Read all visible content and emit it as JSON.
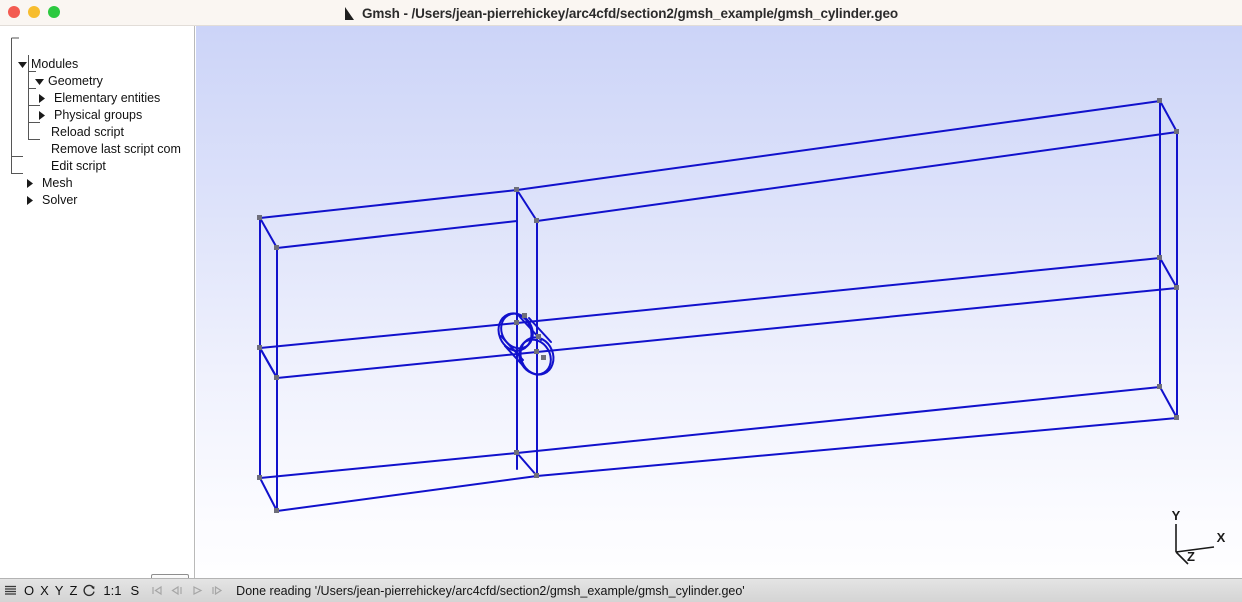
{
  "window": {
    "title": "Gmsh - /Users/jean-pierrehickey/arc4cfd/section2/gmsh_example/gmsh_cylinder.geo",
    "logo_icon": "gmsh-triangle-logo",
    "traffic_lights": [
      {
        "name": "close",
        "color": "#f35b51"
      },
      {
        "name": "minimize",
        "color": "#f7bd2e"
      },
      {
        "name": "zoom",
        "color": "#2cc940"
      }
    ],
    "titlebar_bg": "#faf6f2"
  },
  "sidebar": {
    "tree": [
      {
        "label": "Modules",
        "indent": 0,
        "toggle": "expanded"
      },
      {
        "label": "Geometry",
        "indent": 1,
        "toggle": "expanded"
      },
      {
        "label": "Elementary entities",
        "indent": 2,
        "toggle": "collapsed"
      },
      {
        "label": "Physical groups",
        "indent": 2,
        "toggle": "collapsed"
      },
      {
        "label": "Reload script",
        "indent": 2,
        "toggle": "leaf"
      },
      {
        "label": "Remove last script com",
        "indent": 2,
        "toggle": "leaf"
      },
      {
        "label": "Edit script",
        "indent": 2,
        "toggle": "leaf"
      },
      {
        "label": "Mesh",
        "indent": 1,
        "toggle": "collapsed"
      },
      {
        "label": "Solver",
        "indent": 1,
        "toggle": "collapsed"
      }
    ],
    "options_button": {
      "icon": "gear-icon",
      "dropdown_icon": "triangle-down-icon"
    }
  },
  "viewport": {
    "background_top": "#ccd4f8",
    "background_bottom": "#fefeff",
    "geometry_color": "#1111cc",
    "vertex_color": "#6e6e7a",
    "axes": {
      "y_label": "Y",
      "x_label": "X",
      "z_label": "Z"
    }
  },
  "statusbar": {
    "buttons": [
      {
        "name": "menu",
        "label": "",
        "icon": "hamburger-icon",
        "dim": false
      },
      {
        "name": "ortho",
        "label": "O",
        "icon": "",
        "dim": false
      },
      {
        "name": "x-view",
        "label": "X",
        "icon": "",
        "dim": false
      },
      {
        "name": "y-view",
        "label": "Y",
        "icon": "",
        "dim": false
      },
      {
        "name": "z-view",
        "label": "Z",
        "icon": "",
        "dim": false
      },
      {
        "name": "rotate",
        "label": "",
        "icon": "rotate-icon",
        "dim": false
      },
      {
        "name": "scale",
        "label": "1:1",
        "icon": "",
        "dim": false
      },
      {
        "name": "shading",
        "label": "S",
        "icon": "",
        "dim": false
      },
      {
        "name": "first",
        "label": "",
        "icon": "skip-first-icon",
        "dim": true
      },
      {
        "name": "prev",
        "label": "",
        "icon": "step-back-icon",
        "dim": true
      },
      {
        "name": "play",
        "label": "",
        "icon": "play-icon",
        "dim": true
      },
      {
        "name": "next",
        "label": "",
        "icon": "step-fwd-icon",
        "dim": true
      }
    ],
    "message": "Done reading '/Users/jean-pierrehickey/arc4cfd/section2/gmsh_example/gmsh_cylinder.geo'"
  }
}
